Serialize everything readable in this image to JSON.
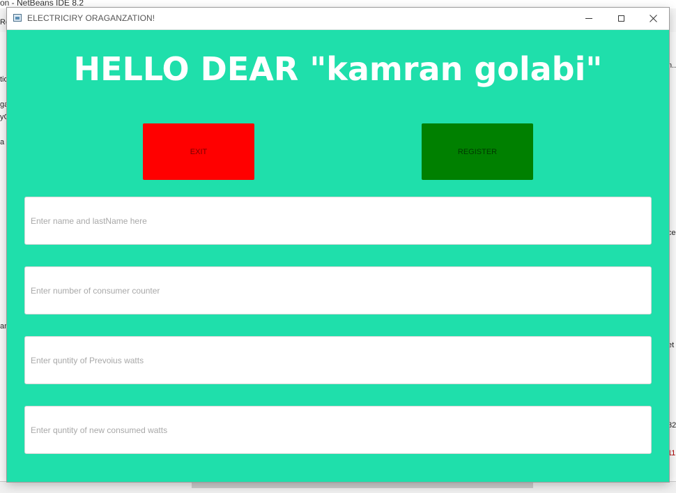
{
  "background_ide": {
    "title_fragment": "on - NetBeans IDE 8.2",
    "left_fragments": [
      "Re",
      "tio",
      "ga",
      "yC",
      "a",
      "anS"
    ],
    "right_fragments": [
      "n..",
      "ce",
      "et",
      "32",
      "11"
    ]
  },
  "window": {
    "title": "ELECTRICIRY ORAGANZATION!",
    "bg_color": "#1fdfab"
  },
  "greeting": "HELLO DEAR \"kamran golabi\"",
  "buttons": {
    "exit_label": "EXIT",
    "exit_color": "#ff0000",
    "register_label": "REGISTER",
    "register_color": "#008000"
  },
  "fields": [
    {
      "placeholder": "Enter name and lastName here",
      "value": ""
    },
    {
      "placeholder": "Enter number of consumer counter",
      "value": ""
    },
    {
      "placeholder": "Enter quntity of Prevoius watts",
      "value": ""
    },
    {
      "placeholder": "Enter quntity of new consumed watts",
      "value": ""
    }
  ],
  "icons": {
    "app": "java-window-icon",
    "minimize": "minimize-icon",
    "maximize": "maximize-icon",
    "close": "close-icon"
  }
}
